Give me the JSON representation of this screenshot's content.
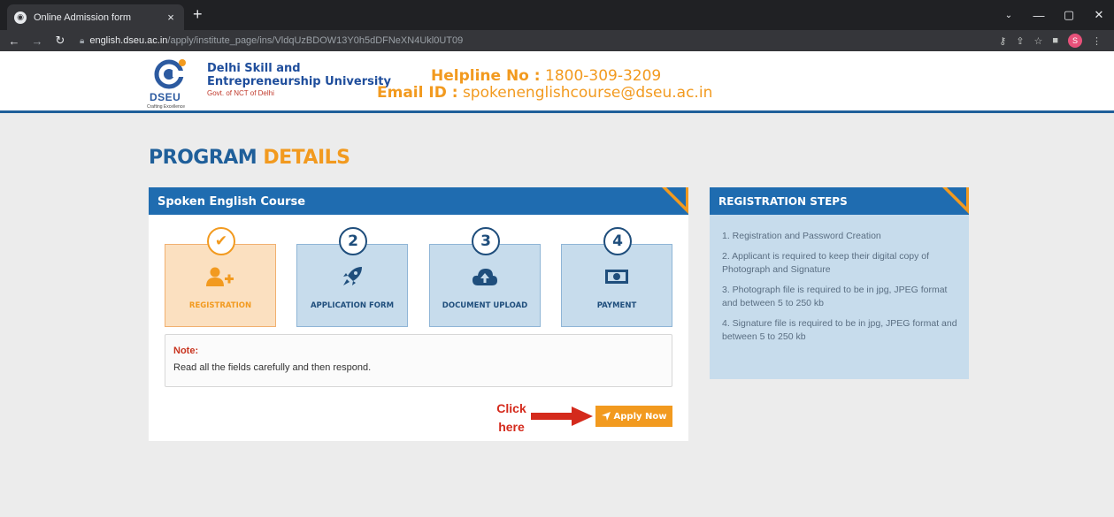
{
  "browser": {
    "tab_title": "Online Admission form",
    "tab_close": "×",
    "new_tab": "+",
    "url_host": "english.dseu.ac.in",
    "url_path": "/apply/institute_page/ins/VldqUzBDOW13Y0h5dDFNeXN4Ukl0UT09",
    "profile_initial": "S"
  },
  "header": {
    "logo_text": "DSEU",
    "logo_tagline": "Crafting Excellence",
    "university_name_line1": "Delhi Skill and",
    "university_name_line2": "Entrepreneurship University",
    "government": "Govt. of NCT of Delhi",
    "helpline_label": "Helpline No :",
    "helpline_number": "1800-309-3209",
    "email_label": "Email ID :",
    "email": "spokenenglishcourse@dseu.ac.in"
  },
  "page": {
    "title_part1": "PROGRAM",
    "title_part2": "DETAILS"
  },
  "program": {
    "course_name": "Spoken English Course",
    "steps": [
      {
        "number": "✔",
        "label": "REGISTRATION",
        "icon": "user-add-icon"
      },
      {
        "number": "2",
        "label": "APPLICATION FORM",
        "icon": "rocket-icon"
      },
      {
        "number": "3",
        "label": "DOCUMENT UPLOAD",
        "icon": "cloud-upload-icon"
      },
      {
        "number": "4",
        "label": "PAYMENT",
        "icon": "money-icon"
      }
    ],
    "note_title": "Note:",
    "note_text": "Read all the fields carefully and then respond.",
    "click_here_line1": "Click",
    "click_here_line2": "here",
    "apply_label": "Apply Now"
  },
  "registration_steps": {
    "title": "REGISTRATION STEPS",
    "items": [
      "1. Registration and Password Creation",
      "2. Applicant is required to keep their digital copy of Photograph and Signature",
      "3. Photograph file is required to be in jpg, JPEG format and between 5 to 250 kb",
      "4. Signature file is required to be in jpg, JPEG format and between 5 to 250 kb"
    ]
  },
  "colors": {
    "primary_blue": "#1f6cb0",
    "accent_orange": "#f29a1f",
    "step_bg": "#c7dcec",
    "active_step_bg": "#fbe0c0"
  }
}
